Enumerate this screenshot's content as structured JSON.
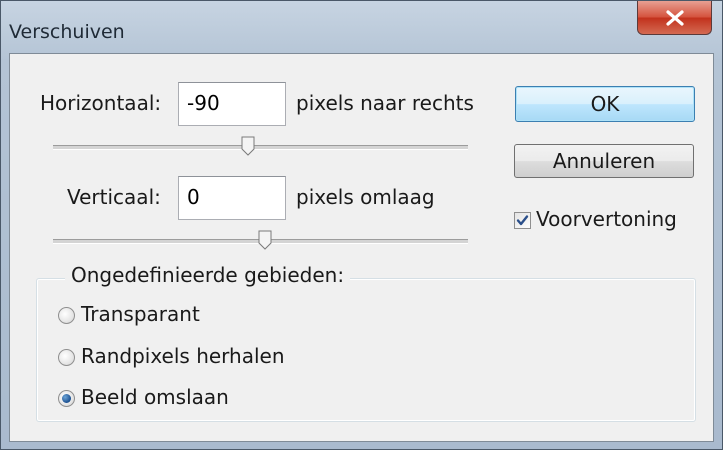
{
  "window": {
    "title": "Verschuiven",
    "close_icon": "close-icon"
  },
  "horizontal": {
    "label": "Horizontaal:",
    "value": "-90",
    "unit": "pixels naar rechts",
    "slider_fraction": 0.47
  },
  "vertical": {
    "label": "Verticaal:",
    "value": "0",
    "unit": "pixels omlaag",
    "slider_fraction": 0.51
  },
  "buttons": {
    "ok": "OK",
    "cancel": "Annuleren"
  },
  "preview": {
    "label": "Voorvertoning",
    "checked": true
  },
  "undefined_areas": {
    "legend": "Ongedefinieerde gebieden:",
    "options": [
      {
        "label": "Transparant",
        "selected": false
      },
      {
        "label": "Randpixels herhalen",
        "selected": false
      },
      {
        "label": "Beeld omslaan",
        "selected": true
      }
    ]
  },
  "colors": {
    "title_bar": "#b4c4d5",
    "dialog_bg": "#f0f0f0",
    "close_button": "#c94a33",
    "default_button": "#bee6fd"
  }
}
